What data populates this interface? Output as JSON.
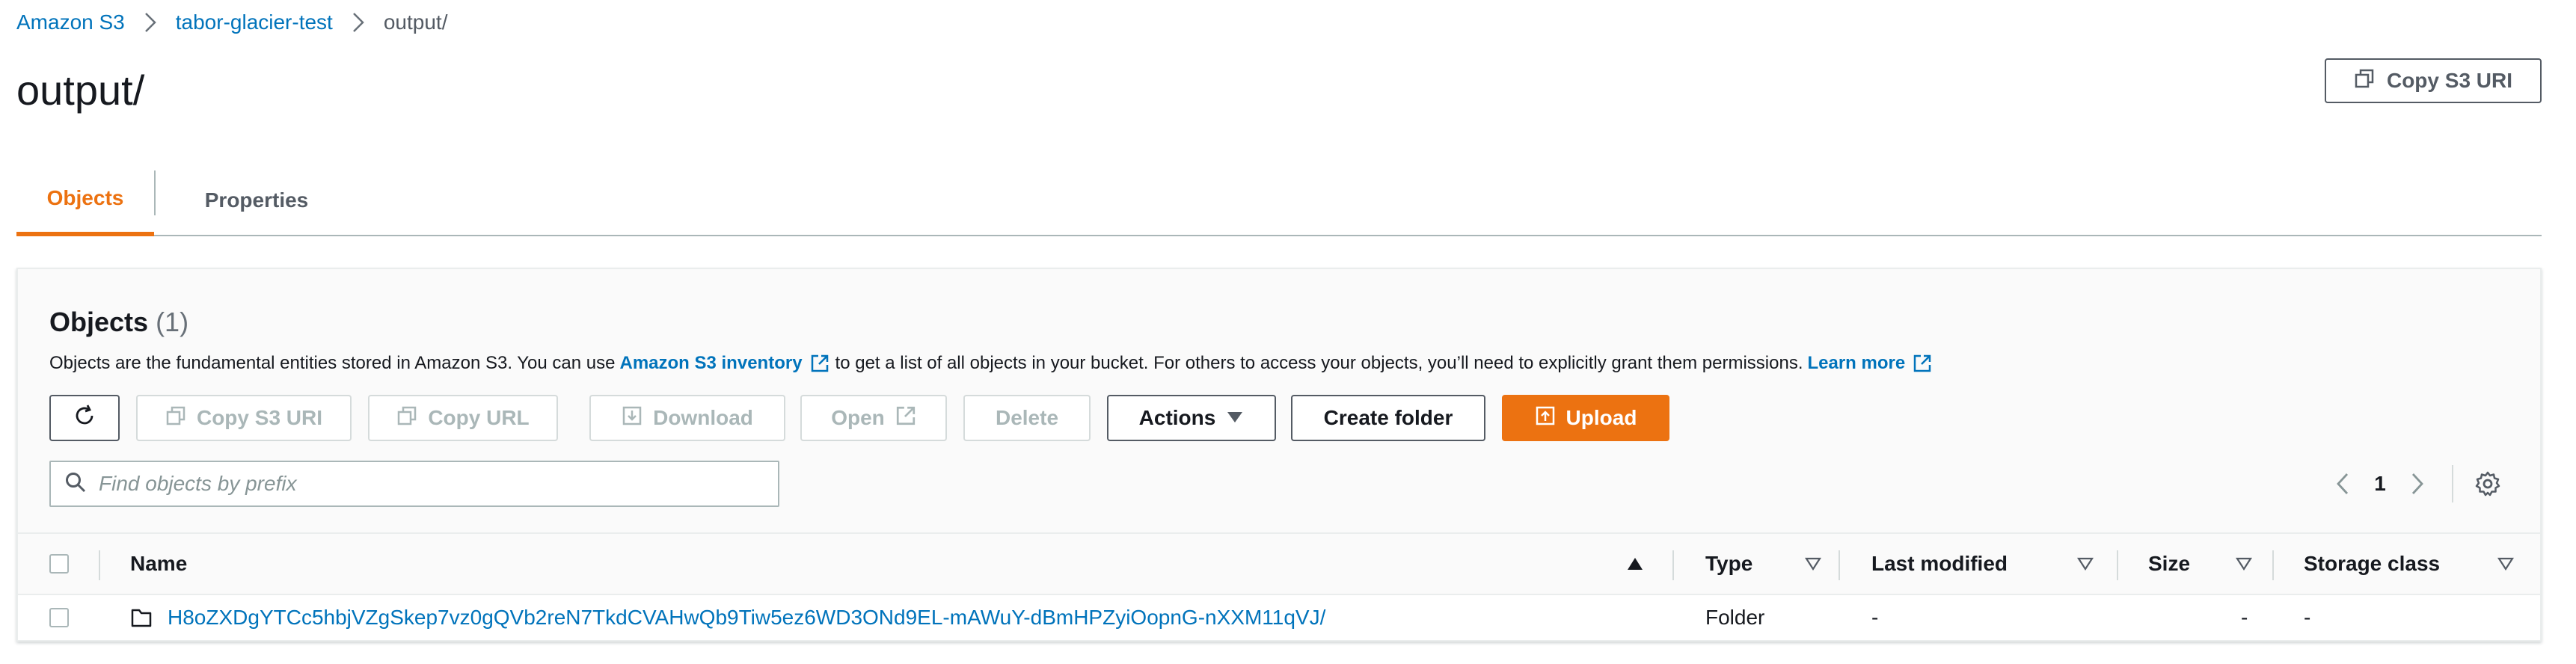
{
  "breadcrumb": {
    "items": [
      "Amazon S3",
      "tabor-glacier-test"
    ],
    "current": "output/"
  },
  "page": {
    "title": "output/",
    "copy_uri_label": "Copy S3 URI"
  },
  "tabs": [
    {
      "label": "Objects",
      "active": true
    },
    {
      "label": "Properties",
      "active": false
    }
  ],
  "panel": {
    "title": "Objects",
    "count": "(1)",
    "description": {
      "before": "Objects are the fundamental entities stored in Amazon S3. You can use",
      "inventory_link": "Amazon S3 inventory",
      "middle": "to get a list of all objects in your bucket. For others to access your objects, you’ll need to explicitly grant them permissions.",
      "learn_more": "Learn more"
    }
  },
  "toolbar": {
    "copy_s3_uri": "Copy S3 URI",
    "copy_url": "Copy URL",
    "download": "Download",
    "open": "Open",
    "delete": "Delete",
    "actions": "Actions",
    "create_folder": "Create folder",
    "upload": "Upload"
  },
  "search": {
    "placeholder": "Find objects by prefix",
    "value": ""
  },
  "pagination": {
    "current_page": "1"
  },
  "table": {
    "columns": [
      "Name",
      "Type",
      "Last modified",
      "Size",
      "Storage class"
    ],
    "rows": [
      {
        "name": "H8oZXDgYTCc5hbjVZgSkep7vz0gQVb2reN7TkdCVAHwQb9Tiw5ez6WD3ONd9EL-mAWuY-dBmHPZyiOopnG-nXXM11qVJ/",
        "type": "Folder",
        "last_modified": "-",
        "size": "-",
        "storage_class": "-"
      }
    ]
  },
  "colors": {
    "accent": "#ec7211",
    "link": "#0073bb",
    "text": "#16191f",
    "muted": "#545b64",
    "disabled": "#aab7b8"
  },
  "icons": [
    "chevron-right-icon",
    "copy-icon",
    "refresh-icon",
    "download-icon",
    "external-link-icon",
    "caret-down-icon",
    "upload-icon",
    "search-icon",
    "chevron-left-icon",
    "gear-icon",
    "folder-icon",
    "sort-ascending-icon",
    "sort-descending-icon"
  ]
}
